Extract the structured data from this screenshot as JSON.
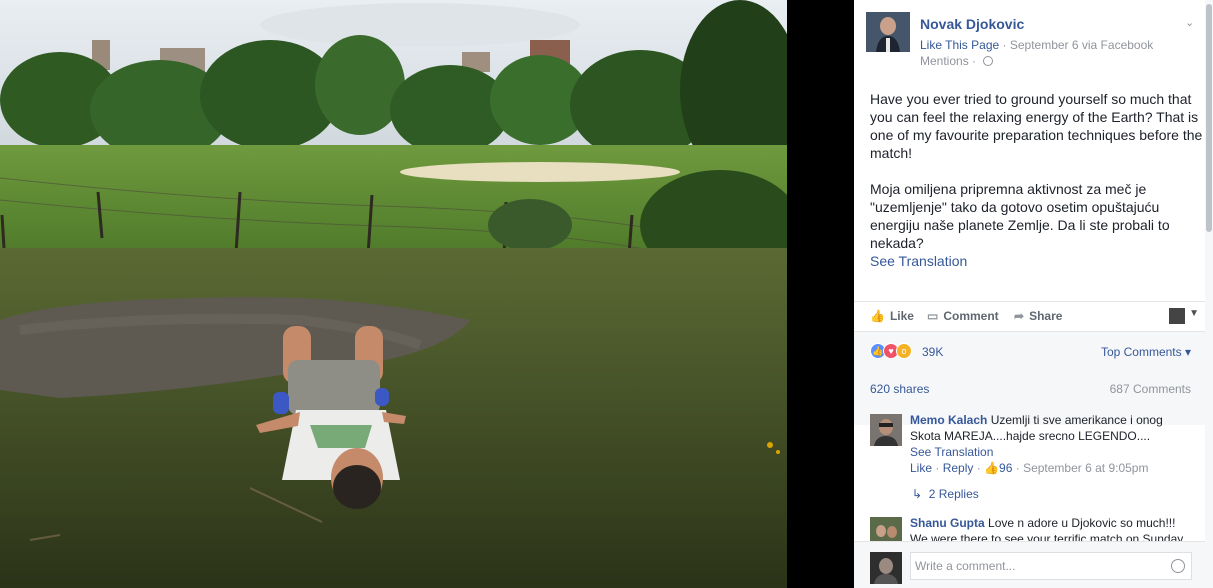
{
  "colors": {
    "link": "#365899",
    "muted": "#90949c",
    "text": "#1d2129"
  },
  "header": {
    "page_name": "Novak Djokovic",
    "like_link": "Like This Page",
    "meta": "· September 6 via Facebook Mentions ·"
  },
  "post": {
    "en": "Have you ever tried to ground yourself so much that you can feel the relaxing energy of the Earth? That is one of my favourite preparation techniques before the match!",
    "sr": "Moja omiljena pripremna aktivnost za meč je \"uzemljenje\" tako da gotovo osetim opuštajuću energiju naše planete Zemlje. Da li ste probali to nekada?",
    "see_translation": "See Translation"
  },
  "actions": {
    "like": "Like",
    "comment": "Comment",
    "share": "Share"
  },
  "stats": {
    "reactions": "39K",
    "top_comments": "Top Comments",
    "shares": "620 shares",
    "comments": "687 Comments"
  },
  "comments": [
    {
      "author": "Memo Kalach",
      "text": "Uzemlji ti sve amerikance i onog Skota MAREJA....hajde srecno LEGENDO....",
      "see_translation": "See Translation",
      "like": "Like",
      "reply": "Reply",
      "likes": "96",
      "time": "· September 6 at 9:05pm",
      "replies": "2 Replies"
    },
    {
      "author": "Shanu Gupta",
      "text": "Love n adore u Djokovic so much!!! We were there to see your terrific match on Sunday"
    }
  ],
  "composer": {
    "placeholder": "Write a comment..."
  }
}
